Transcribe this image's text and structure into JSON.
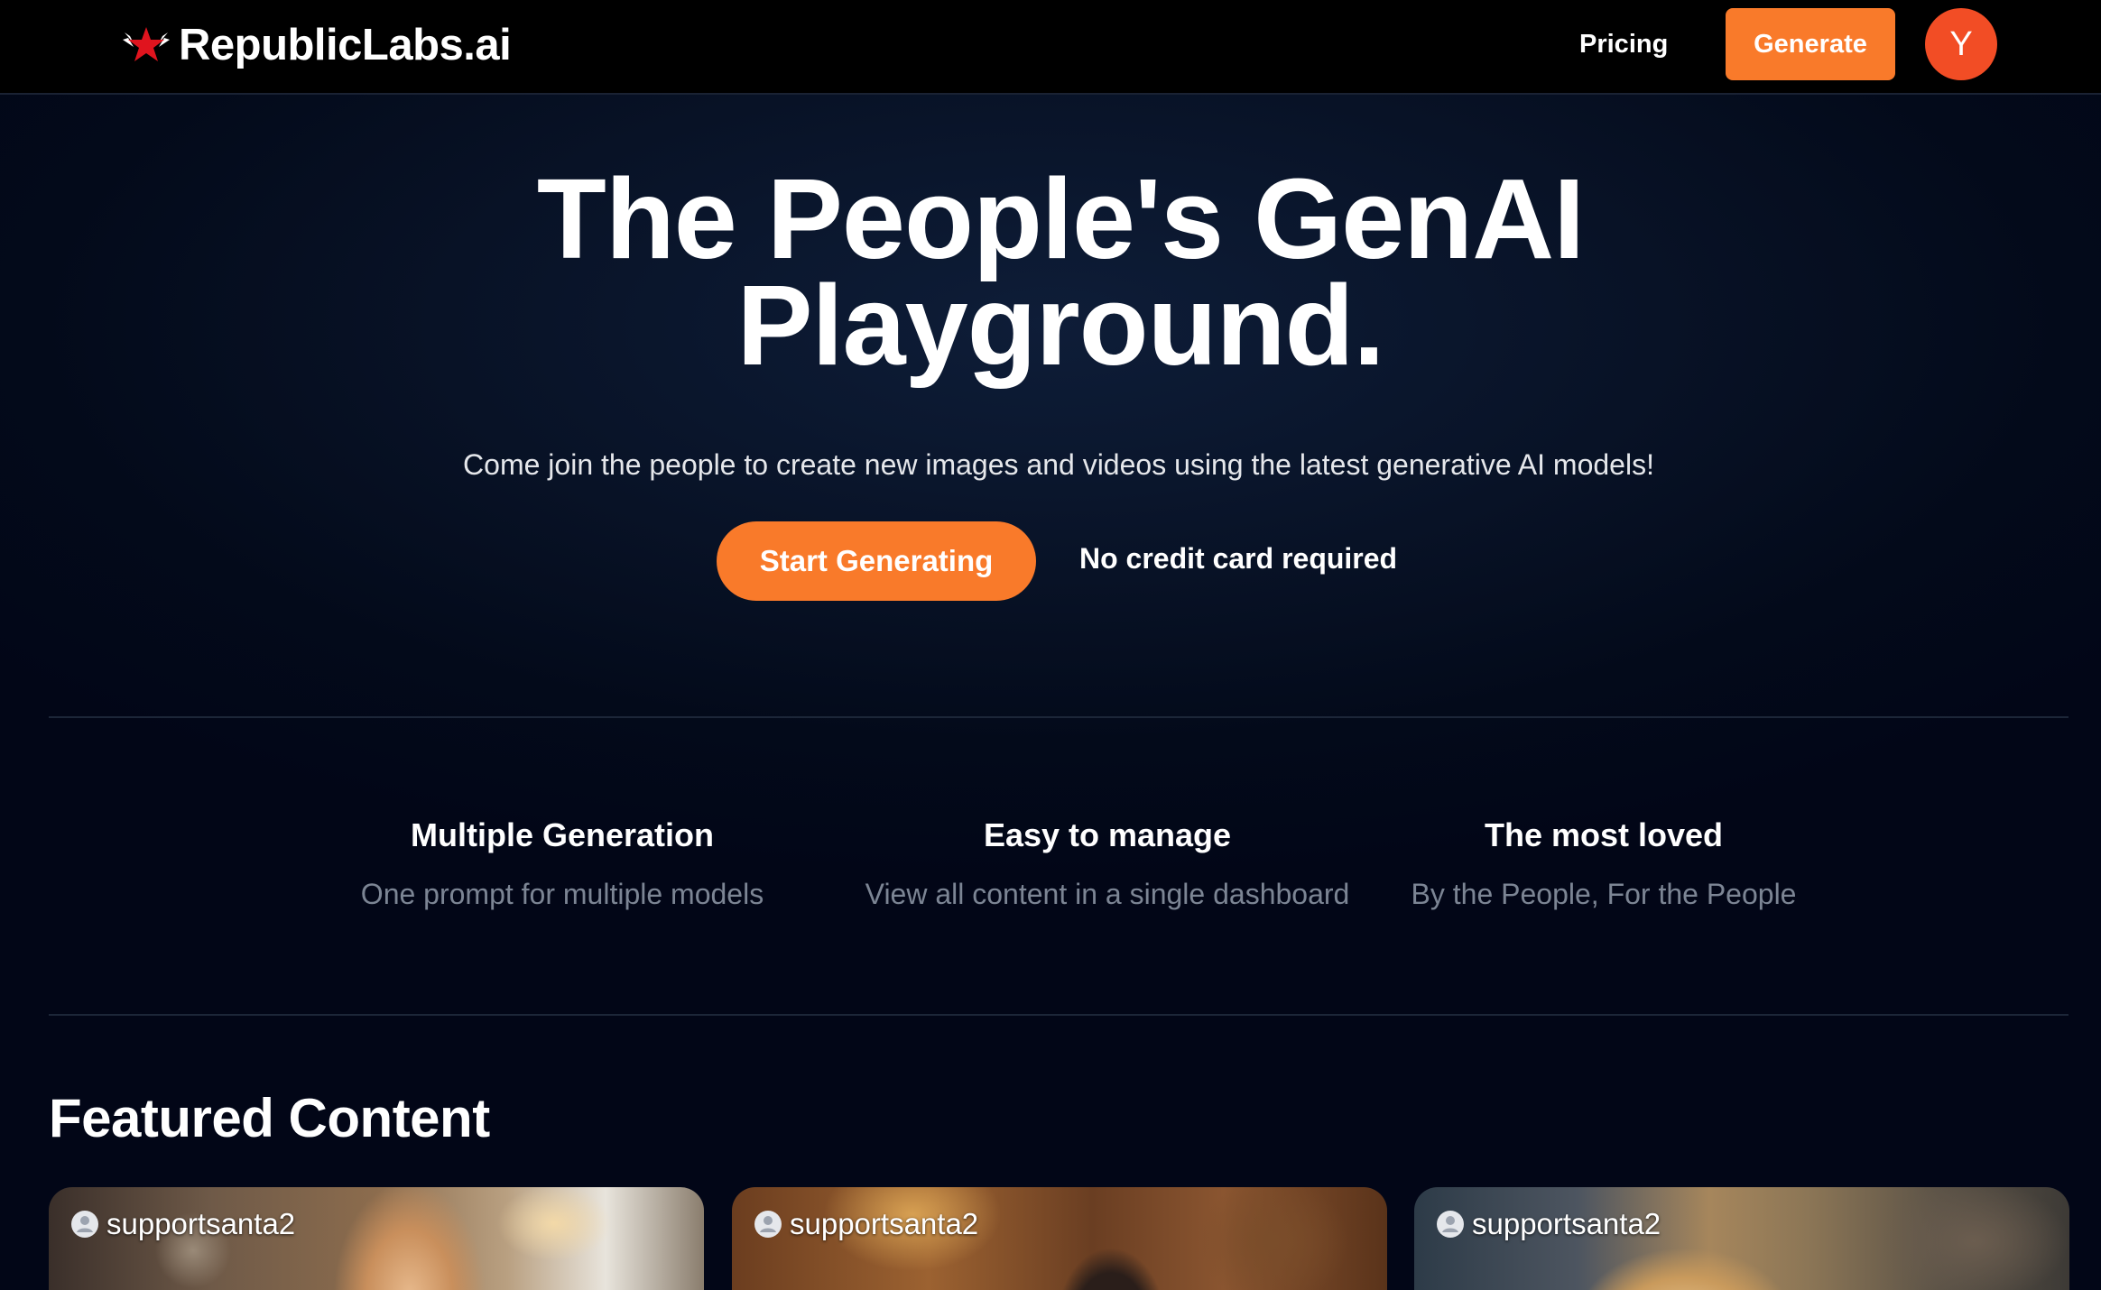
{
  "header": {
    "brand": "RepublicLabs.ai",
    "nav_pricing": "Pricing",
    "generate_label": "Generate",
    "avatar_initial": "Y"
  },
  "hero": {
    "title_line1": "The People's GenAI",
    "title_line2": "Playground.",
    "subtitle": "Come join the people to create new images and videos using the latest generative AI models!",
    "cta_label": "Start Generating",
    "note": "No credit card required"
  },
  "features": [
    {
      "title": "Multiple Generation",
      "desc": "One prompt for multiple models"
    },
    {
      "title": "Easy to manage",
      "desc": "View all content in a single dashboard"
    },
    {
      "title": "The most loved",
      "desc": "By the People, For the People"
    }
  ],
  "featured": {
    "heading": "Featured Content",
    "cards": [
      {
        "user": "supportsanta2"
      },
      {
        "user": "supportsanta2"
      },
      {
        "user": "supportsanta2"
      }
    ]
  },
  "colors": {
    "accent": "#f97a2a",
    "avatar": "#f24d25",
    "background": "#020617"
  }
}
